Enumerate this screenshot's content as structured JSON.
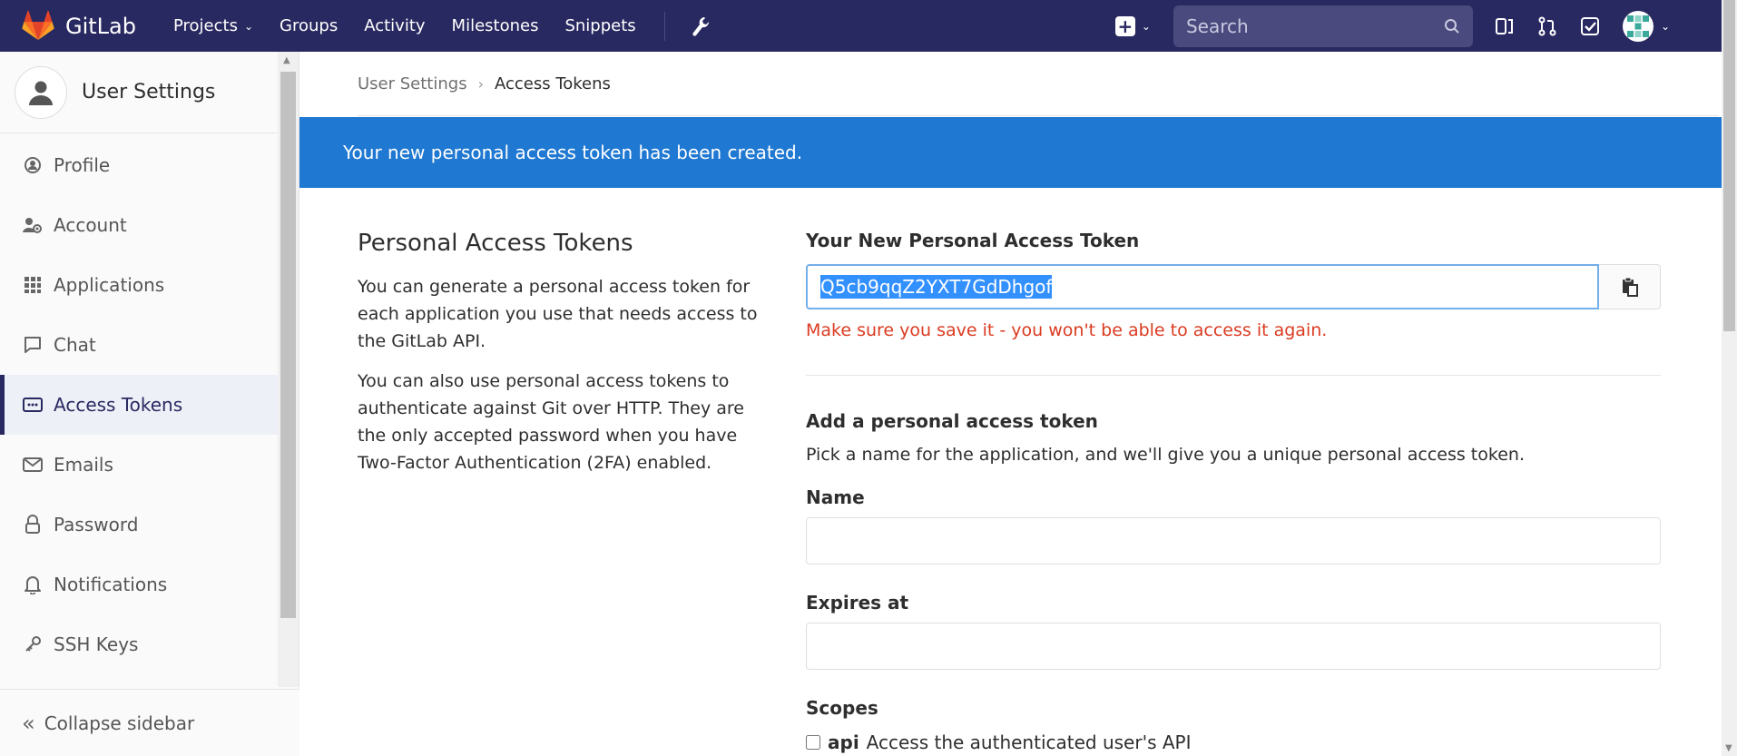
{
  "navbar": {
    "logo_text": "GitLab",
    "links": [
      "Projects",
      "Groups",
      "Activity",
      "Milestones",
      "Snippets"
    ],
    "search_placeholder": "Search",
    "brand_color": "#292961"
  },
  "sidebar": {
    "title": "User Settings",
    "items": [
      {
        "label": "Profile",
        "icon": "profile-icon"
      },
      {
        "label": "Account",
        "icon": "account-icon"
      },
      {
        "label": "Applications",
        "icon": "applications-icon"
      },
      {
        "label": "Chat",
        "icon": "chat-icon"
      },
      {
        "label": "Access Tokens",
        "icon": "access-tokens-icon",
        "active": true
      },
      {
        "label": "Emails",
        "icon": "email-icon"
      },
      {
        "label": "Password",
        "icon": "lock-icon"
      },
      {
        "label": "Notifications",
        "icon": "bell-icon"
      },
      {
        "label": "SSH Keys",
        "icon": "key-icon"
      }
    ],
    "collapse_label": "Collapse sidebar"
  },
  "breadcrumb": {
    "parent": "User Settings",
    "current": "Access Tokens"
  },
  "flash": {
    "message": "Your new personal access token has been created.",
    "color": "#1f78d1"
  },
  "left": {
    "title": "Personal Access Tokens",
    "p1": "You can generate a personal access token for each application you use that needs access to the GitLab API.",
    "p2": "You can also use personal access tokens to authenticate against Git over HTTP. They are the only accepted password when you have Two-Factor Authentication (2FA) enabled."
  },
  "token": {
    "label": "Your New Personal Access Token",
    "value": "Q5cb9qqZ2YXT7GdDhgof",
    "warning": "Make sure you save it - you won't be able to access it again."
  },
  "form": {
    "heading": "Add a personal access token",
    "subtext": "Pick a name for the application, and we'll give you a unique personal access token.",
    "name_label": "Name",
    "expires_label": "Expires at",
    "scopes_label": "Scopes",
    "scope_api_name": "api",
    "scope_api_desc": "Access the authenticated user's API"
  }
}
